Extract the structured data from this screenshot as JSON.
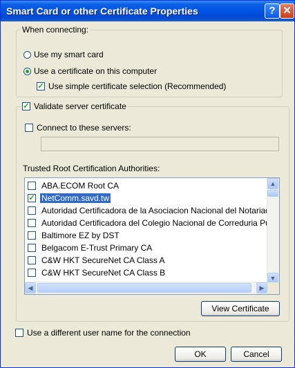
{
  "window": {
    "title": "Smart Card or other Certificate Properties",
    "help_glyph": "?",
    "close_glyph": "✕"
  },
  "when_connecting": {
    "legend": "When connecting:",
    "use_smart_card": "Use my smart card",
    "use_certificate": "Use a certificate on this computer",
    "simple_selection": "Use simple certificate selection (Recommended)"
  },
  "validate": {
    "label": "Validate server certificate",
    "connect_servers": "Connect to these servers:",
    "servers_value": "",
    "trusted_label": "Trusted Root Certification Authorities:",
    "cas": [
      {
        "name": "ABA.ECOM Root CA",
        "checked": false
      },
      {
        "name": "NetComm.savd.tw",
        "checked": true,
        "selected": true
      },
      {
        "name": "Autoridad Certificadora de la Asociacion Nacional del Notariado Mexicano",
        "checked": false
      },
      {
        "name": "Autoridad Certificadora del Colegio Nacional de Correduria Publica",
        "checked": false
      },
      {
        "name": "Baltimore EZ by DST",
        "checked": false
      },
      {
        "name": "Belgacom E-Trust Primary CA",
        "checked": false
      },
      {
        "name": "C&W HKT SecureNet CA Class A",
        "checked": false
      },
      {
        "name": "C&W HKT SecureNet CA Class B",
        "checked": false
      }
    ],
    "view_certificate": "View Certificate"
  },
  "different_user": "Use a different user name for the connection",
  "buttons": {
    "ok": "OK",
    "cancel": "Cancel"
  },
  "checkmark": "✓"
}
